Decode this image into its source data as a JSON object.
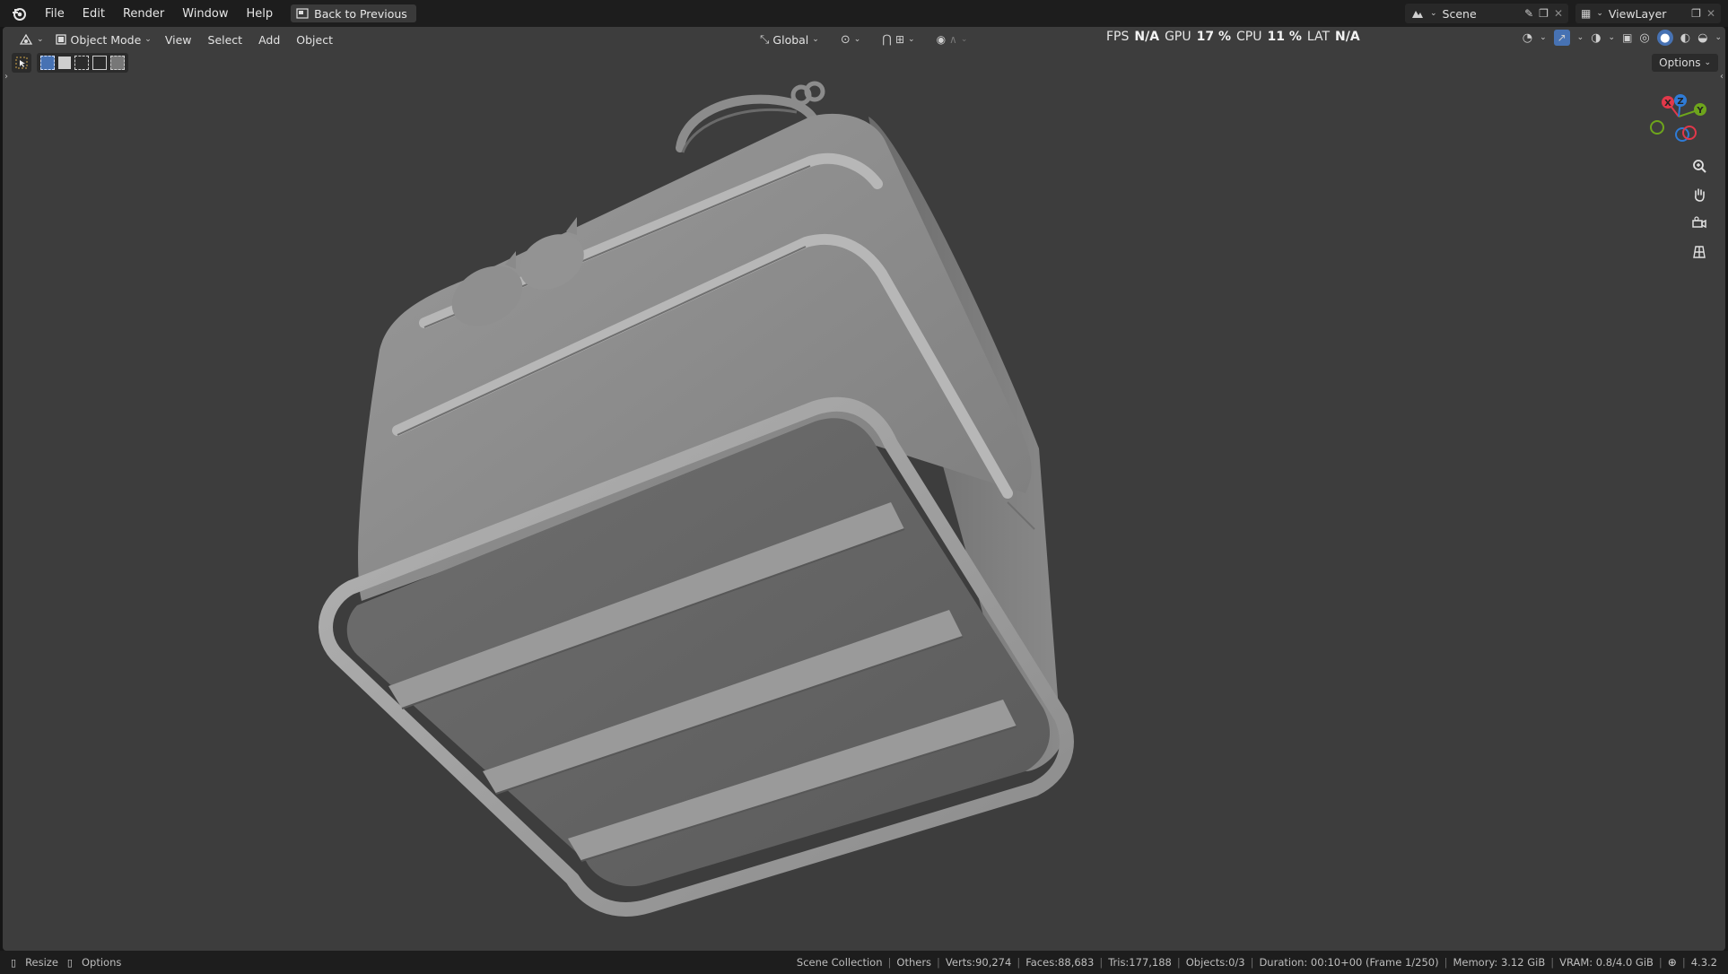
{
  "menubar": {
    "items": [
      "File",
      "Edit",
      "Render",
      "Window",
      "Help"
    ],
    "back_button": "Back to Previous"
  },
  "workspace": {
    "scene": "Scene",
    "view_layer": "ViewLayer"
  },
  "viewport_header": {
    "mode": "Object Mode",
    "menus": [
      "View",
      "Select",
      "Add",
      "Object"
    ],
    "transform_orientation": "Global",
    "options_label": "Options"
  },
  "performance": {
    "fps_label": "FPS",
    "fps_value": "N/A",
    "gpu_label": "GPU",
    "gpu_value": "17 %",
    "cpu_label": "CPU",
    "cpu_value": "11 %",
    "lat_label": "LAT",
    "lat_value": "N/A"
  },
  "gizmo": {
    "x_label": "X",
    "y_label": "Y",
    "z_label": "Z",
    "x_color": "#e2384a",
    "y_color": "#6ea51c",
    "z_color": "#2f7bd6"
  },
  "statusbar": {
    "left": {
      "resize_label": "Resize",
      "options_label": "Options"
    },
    "scene_collection": "Scene Collection",
    "active": "Others",
    "verts": "Verts:90,274",
    "faces": "Faces:88,683",
    "tris": "Tris:177,188",
    "objects": "Objects:0/3",
    "duration": "Duration: 00:10+00 (Frame 1/250)",
    "memory": "Memory: 3.12 GiB",
    "vram": "VRAM: 0.8/4.0 GiB",
    "version": "4.3.2"
  },
  "colors": {
    "viewport_bg": "#3d3d3d",
    "topbar_bg": "#1d1d1d",
    "accent_blue": "#4772b3"
  }
}
